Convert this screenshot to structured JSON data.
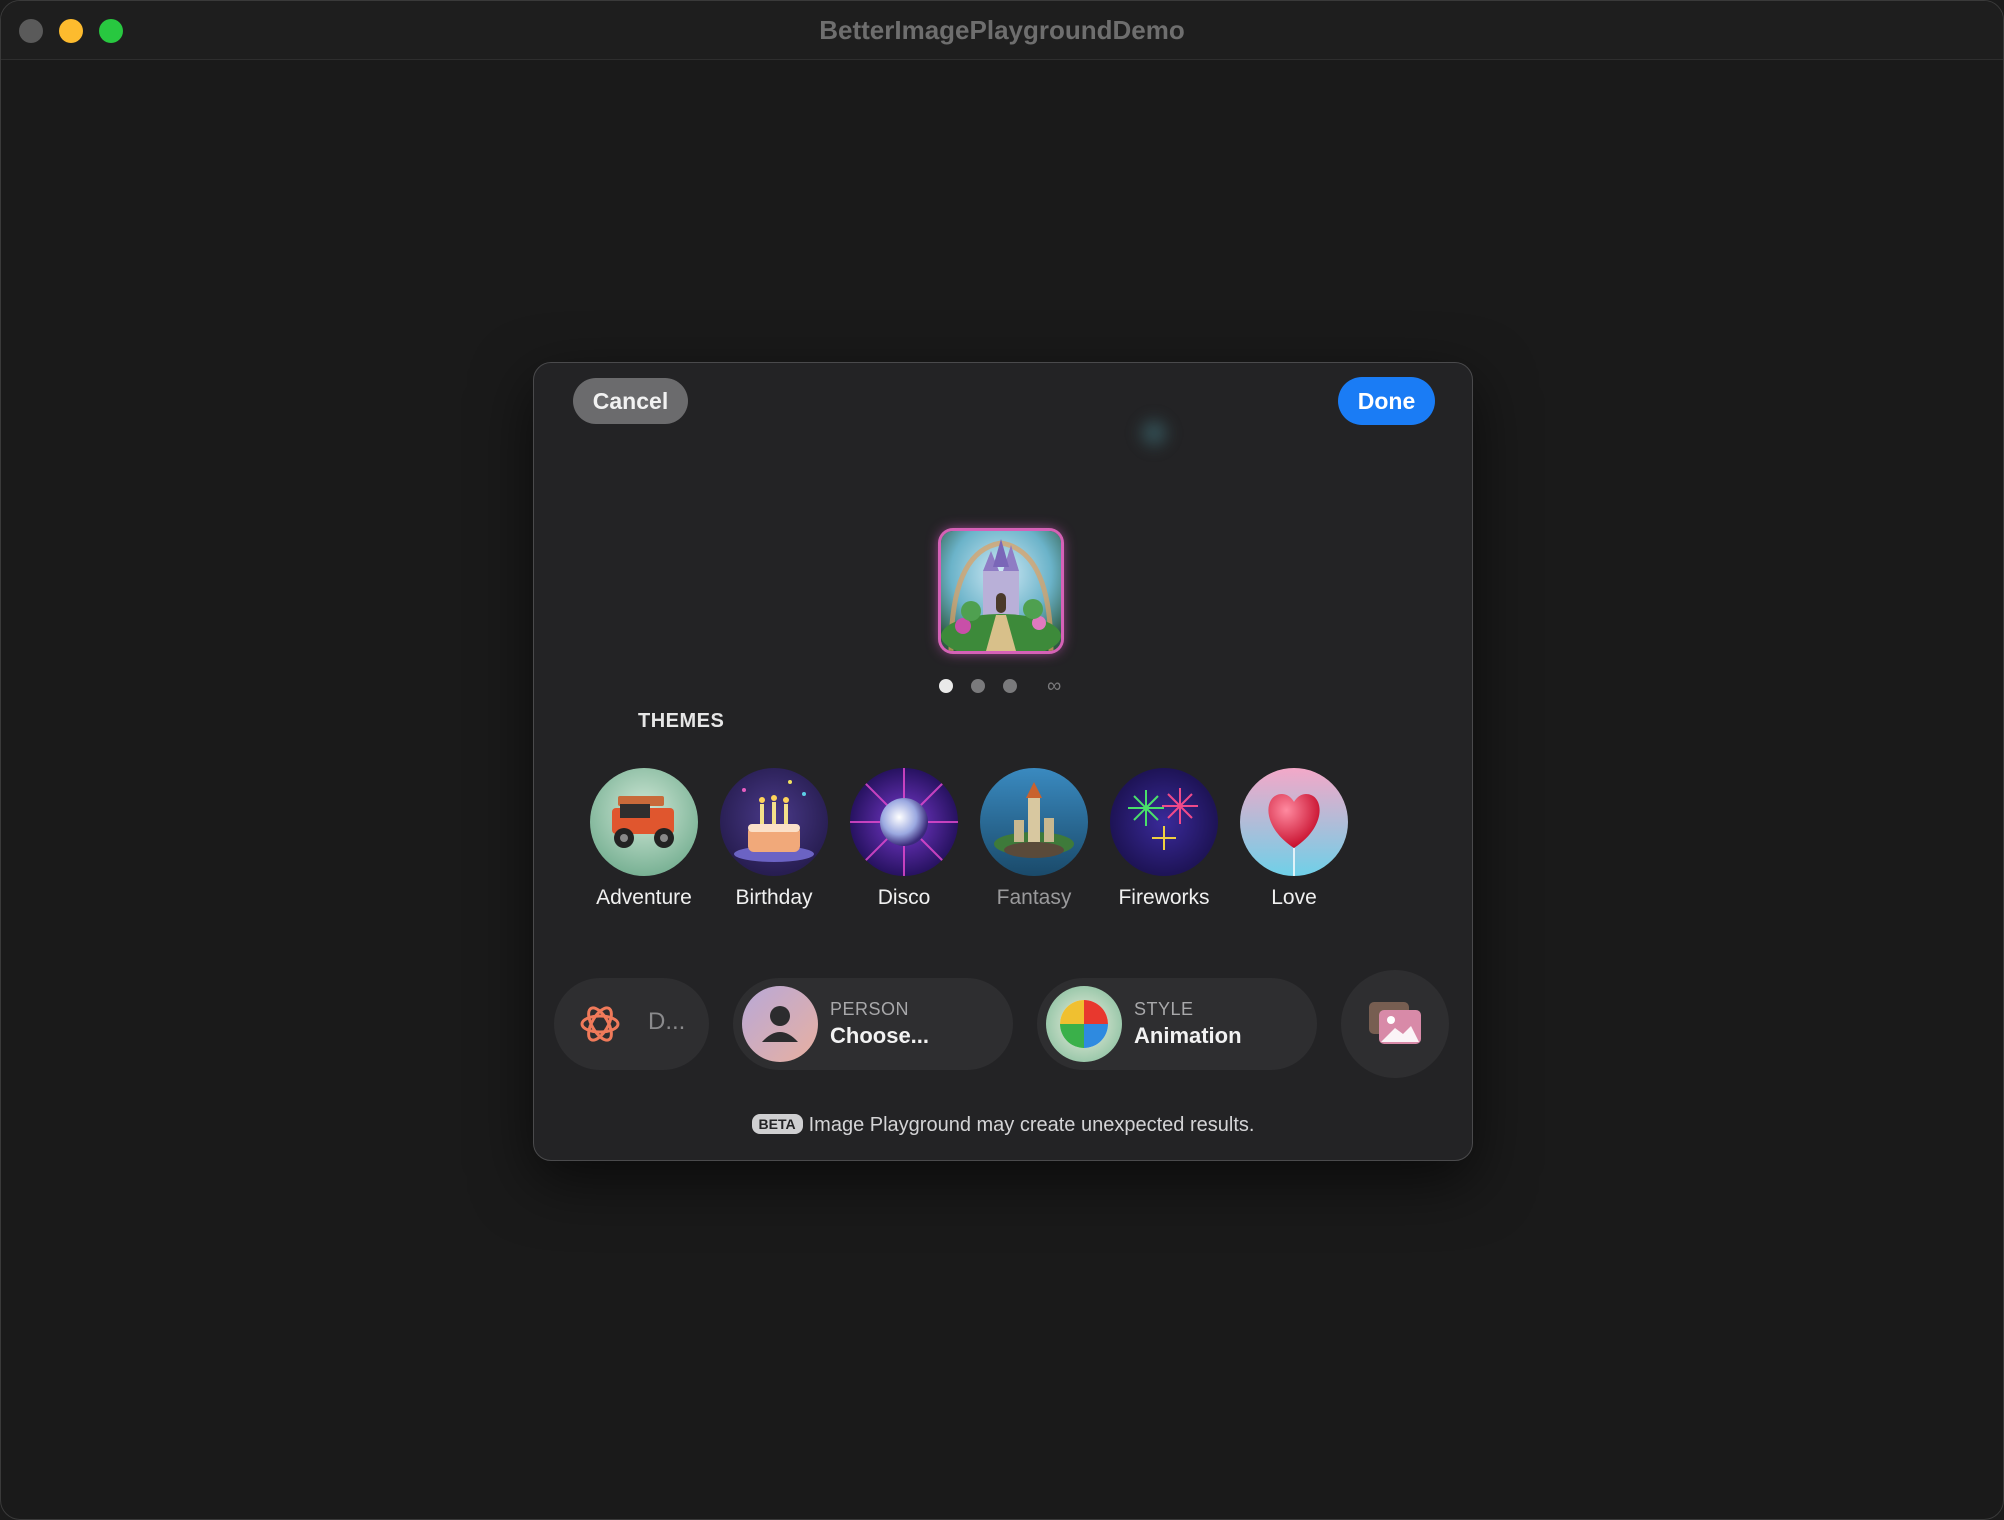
{
  "window": {
    "title": "BetterImagePlaygroundDemo"
  },
  "sheet": {
    "cancel_label": "Cancel",
    "done_label": "Done",
    "page_indicator": {
      "pages": 3,
      "current": 1,
      "more_icon": "infinity-icon"
    },
    "themes_heading": "THEMES",
    "themes": [
      {
        "label": "Adventure",
        "icon": "adventure-jeep-icon"
      },
      {
        "label": "Birthday",
        "icon": "birthday-cake-icon"
      },
      {
        "label": "Disco",
        "icon": "disco-ball-icon"
      },
      {
        "label": "Fantasy",
        "icon": "fantasy-castle-icon"
      },
      {
        "label": "Fireworks",
        "icon": "fireworks-icon"
      },
      {
        "label": "Love",
        "icon": "heart-balloon-icon"
      }
    ],
    "description": {
      "text": "D...",
      "icon": "apple-intelligence-icon"
    },
    "person": {
      "caption": "PERSON",
      "value": "Choose...",
      "icon": "person-icon"
    },
    "style": {
      "caption": "STYLE",
      "value": "Animation",
      "icon": "beach-ball-icon"
    },
    "photo_button": {
      "icon": "photo-library-icon"
    },
    "beta": {
      "badge": "BETA",
      "message": "Image Playground may create unexpected results."
    }
  },
  "colors": {
    "done_button": "#1a7cf5",
    "cancel_button": "#6b6b6d",
    "sheet_background": "#232325",
    "window_background": "#1a1a1a"
  }
}
